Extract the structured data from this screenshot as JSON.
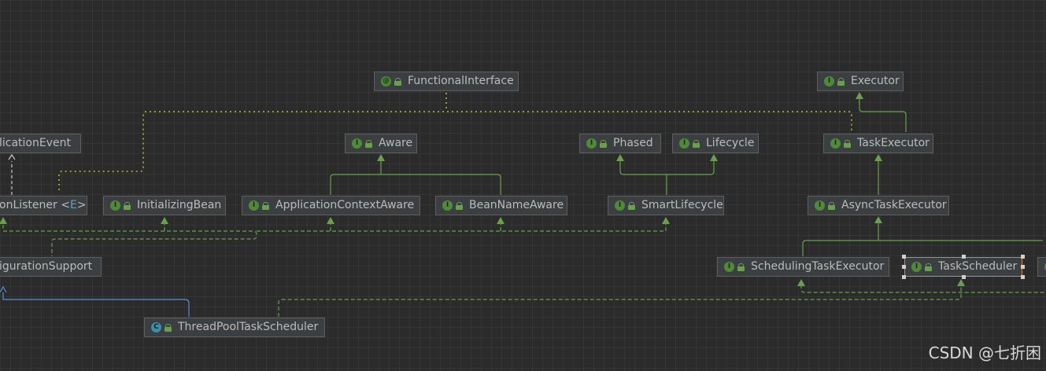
{
  "diagram": {
    "nodes": [
      {
        "id": "functional-interface",
        "label": "FunctionalInterface",
        "kind": "annotation",
        "glyph": "@"
      },
      {
        "id": "executor",
        "label": "Executor",
        "kind": "interface",
        "glyph": "I"
      },
      {
        "id": "application-event",
        "label": "licationEvent",
        "kind": "class",
        "glyph": ""
      },
      {
        "id": "aware",
        "label": "Aware",
        "kind": "interface",
        "glyph": "I"
      },
      {
        "id": "phased",
        "label": "Phased",
        "kind": "interface",
        "glyph": "I"
      },
      {
        "id": "lifecycle",
        "label": "Lifecycle",
        "kind": "interface",
        "glyph": "I"
      },
      {
        "id": "task-executor",
        "label": "TaskExecutor",
        "kind": "interface",
        "glyph": "I"
      },
      {
        "id": "application-listener",
        "label": "onListener <",
        "type_param": "E",
        "label_suffix": ">",
        "kind": "interface",
        "glyph": ""
      },
      {
        "id": "initializing-bean",
        "label": "InitializingBean",
        "kind": "interface",
        "glyph": "I"
      },
      {
        "id": "application-context-aware",
        "label": "ApplicationContextAware",
        "kind": "interface",
        "glyph": "I"
      },
      {
        "id": "bean-name-aware",
        "label": "BeanNameAware",
        "kind": "interface",
        "glyph": "I"
      },
      {
        "id": "smart-lifecycle",
        "label": "SmartLifecycle",
        "kind": "interface",
        "glyph": "I"
      },
      {
        "id": "async-task-executor",
        "label": "AsyncTaskExecutor",
        "kind": "interface",
        "glyph": "I"
      },
      {
        "id": "configuration-support",
        "label": "igurationSupport",
        "kind": "class",
        "glyph": ""
      },
      {
        "id": "scheduling-task-executor",
        "label": "SchedulingTaskExecutor",
        "kind": "interface",
        "glyph": "I"
      },
      {
        "id": "task-scheduler",
        "label": "TaskScheduler",
        "kind": "interface",
        "glyph": "I",
        "selected": true
      },
      {
        "id": "partial-right",
        "label": "",
        "kind": "interface",
        "glyph": "I"
      },
      {
        "id": "thread-pool-task-scheduler",
        "label": "ThreadPoolTaskScheduler",
        "kind": "class",
        "glyph": "C"
      }
    ],
    "colors": {
      "background": "#2b2b2b",
      "node_fill": "#3c3f41",
      "node_border": "#5e6060",
      "text": "#bbbbbb",
      "extends_line": "#6a9f4e",
      "implements_line": "#6a9f4e",
      "annotation_line": "#9a9a2a",
      "class_extends_line": "#5b8ed6",
      "selection_border": "#d08a3a"
    }
  },
  "watermark": "CSDN @七折困"
}
